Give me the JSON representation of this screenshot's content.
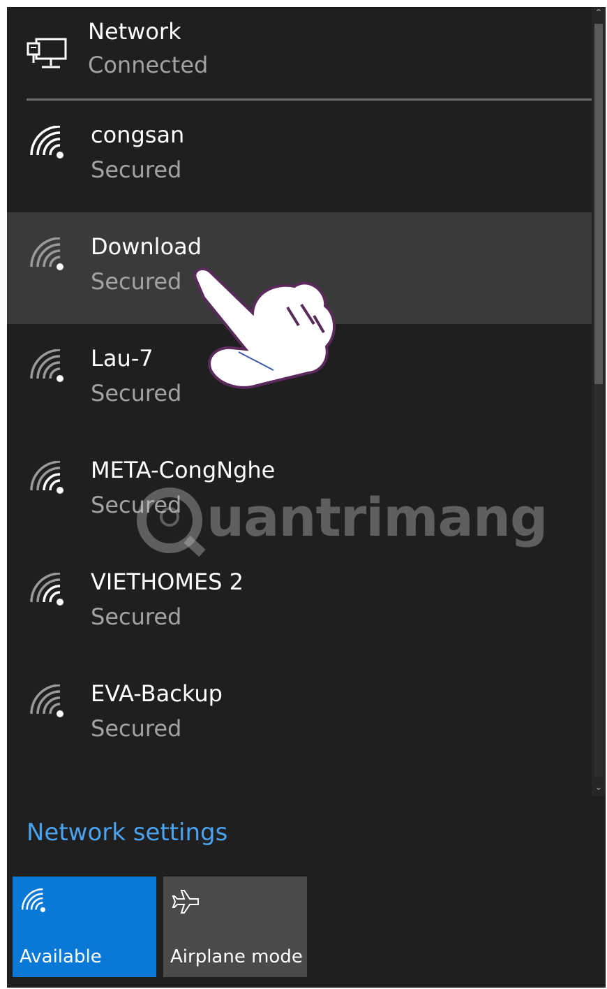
{
  "connected_network": {
    "name": "Network",
    "status": "Connected",
    "icon": "ethernet-icon"
  },
  "wifi_networks": [
    {
      "name": "congsan",
      "status": "Secured",
      "icon": "wifi-icon"
    },
    {
      "name": "Download",
      "status": "Secured",
      "icon": "wifi-icon",
      "selected": true
    },
    {
      "name": "Lau-7",
      "status": "Secured",
      "icon": "wifi-icon"
    },
    {
      "name": "META-CongNghe",
      "status": "Secured",
      "icon": "wifi-icon"
    },
    {
      "name": "VIETHOMES 2",
      "status": "Secured",
      "icon": "wifi-icon"
    },
    {
      "name": "EVA-Backup",
      "status": "Secured",
      "icon": "wifi-icon"
    }
  ],
  "network_settings_label": "Network settings",
  "quick_actions": [
    {
      "label": "Available",
      "icon": "wifi-icon",
      "active": true,
      "color": "#0a78d6"
    },
    {
      "label": "Airplane mode",
      "icon": "airplane-icon",
      "active": false,
      "color": "#4a4a4a"
    }
  ],
  "watermark": "uantrimang",
  "colors": {
    "panel_bg": "#1f1f1f",
    "selected_bg": "#3a3a3a",
    "link": "#4aa3f0",
    "accent": "#0a78d6"
  }
}
